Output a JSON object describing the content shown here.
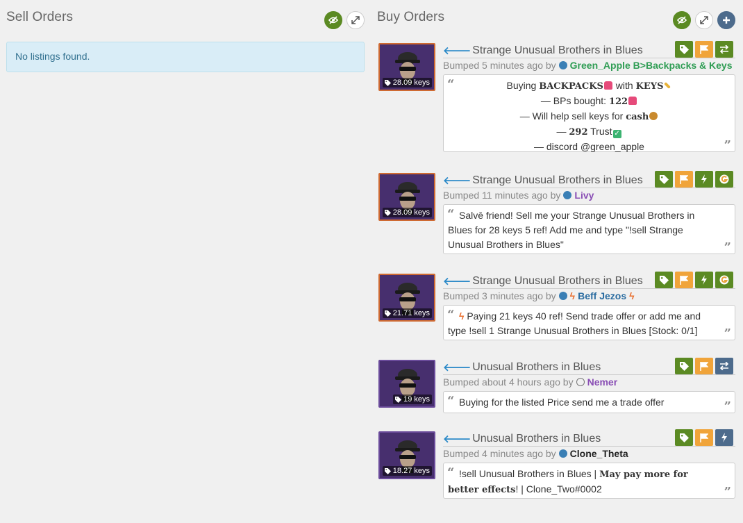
{
  "sell": {
    "title": "Sell Orders",
    "empty_text": "No listings found."
  },
  "buy": {
    "title": "Buy Orders",
    "listings": [
      {
        "title": "Strange Unusual Brothers in Blues",
        "price": "28.09 keys",
        "bumped": "Bumped 5 minutes ago by",
        "user": "Green_Apple B>Backpacks & Keys",
        "buttons": [
          "tag-icon",
          "flag-icon",
          "swap-icon"
        ],
        "lines": [
          "Buying BACKPACKS with KEYS",
          "— BPs bought: 122",
          "— Will help sell keys for cash",
          "— 292 Trust",
          "— discord @green_apple"
        ]
      },
      {
        "title": "Strange Unusual Brothers in Blues",
        "price": "28.09 keys",
        "bumped": "Bumped 11 minutes ago by",
        "user": "Livy",
        "buttons": [
          "tag-icon",
          "flag-icon",
          "lightning-icon",
          "g-icon"
        ],
        "message": "Salvē friend! Sell me your Strange Unusual Brothers in Blues for 28 keys 5 ref! Add me and type \"!sell Strange Unusual Brothers in Blues\""
      },
      {
        "title": "Strange Unusual Brothers in Blues",
        "price": "21.71 keys",
        "bumped": "Bumped 3 minutes ago by",
        "user": "Beff Jezos",
        "buttons": [
          "tag-icon",
          "flag-icon",
          "lightning-icon",
          "g-icon"
        ],
        "message": "Paying 21 keys 40 ref! Send trade offer or add me and type !sell 1 Strange Unusual Brothers in Blues [Stock: 0/1]"
      },
      {
        "title": "Unusual Brothers in Blues",
        "price": "19 keys",
        "bumped": "Bumped about 4 hours ago by",
        "user": "Nemer",
        "buttons": [
          "tag-icon",
          "flag-icon",
          "swap-icon"
        ],
        "message": "Buying for the listed Price send me a trade offer"
      },
      {
        "title": "Unusual Brothers in Blues",
        "price": "18.27 keys",
        "bumped": "Bumped 4 minutes ago by",
        "user": "Clone_Theta",
        "buttons": [
          "tag-icon",
          "flag-icon",
          "lightning-icon"
        ],
        "message_a": "!sell Unusual Brothers in Blues | ",
        "message_b": "May pay more for better effects",
        "message_c": "! | Clone_Two#0002"
      }
    ]
  },
  "colors": {
    "green": "#5b8a23",
    "orange": "#f0a43a",
    "slate": "#4d6b8c",
    "strange_border": "#cf6a32",
    "unusual_bg": "#472f6e",
    "info_bg": "#d9edf7"
  }
}
